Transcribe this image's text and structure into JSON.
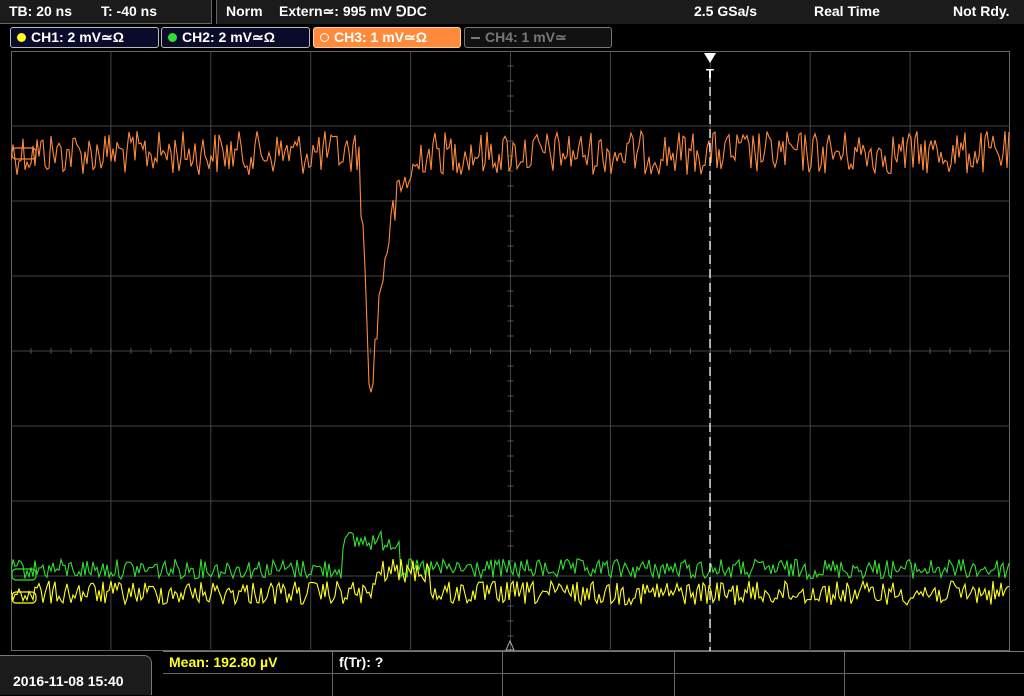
{
  "status": {
    "timebase": "TB: 20 ns",
    "trigger_time": "T: -40 ns",
    "trigger_mode": "Norm",
    "trigger_source": "Extern≃: 995 mV ⅁DC",
    "sample_rate": "2.5 GSa/s",
    "acq_mode": "Real Time",
    "acq_status": "Not Rdy."
  },
  "channels": [
    {
      "label": "CH1: 2 mV≃Ω",
      "color": "#ffff20",
      "active": true
    },
    {
      "label": "CH2: 2 mV≃Ω",
      "color": "#30e030",
      "active": true
    },
    {
      "label": "CH3: 1 mV≃Ω",
      "color": "#ff8a3c",
      "active": true
    },
    {
      "label": "CH4: 1 mV≃",
      "color": "#777777",
      "active": false
    }
  ],
  "trigger_marker": "T",
  "date": "2016-11-08 15:40",
  "measurements": {
    "mean": "Mean: 192.80 µV",
    "freq": "f(Tr): ?"
  },
  "colors": {
    "grid": "#444444",
    "ch1": "#ffff20",
    "ch2": "#30e030",
    "ch3": "#ff8a3c"
  }
}
